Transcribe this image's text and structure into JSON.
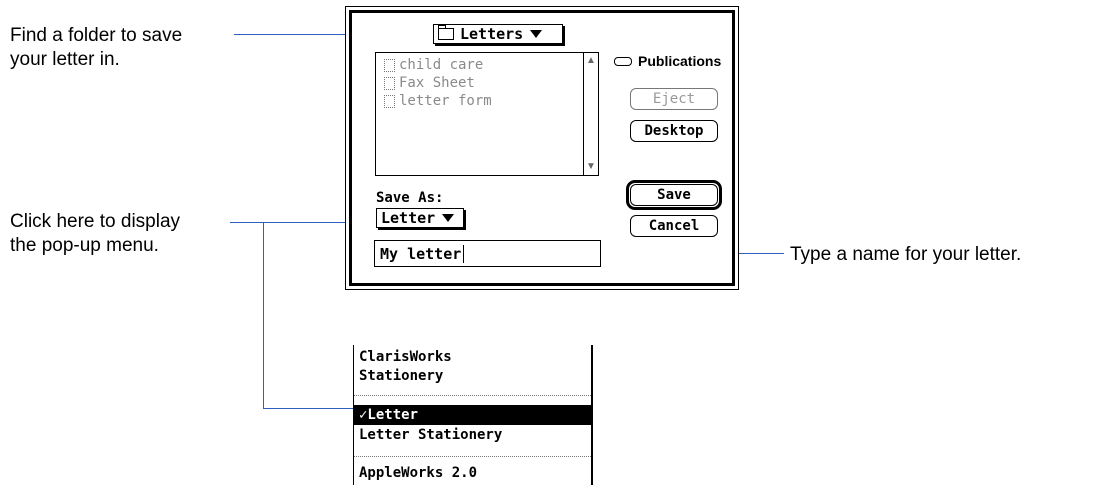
{
  "annotations": {
    "folder_line1": "Find a folder to save",
    "folder_line2": "your letter in.",
    "popup_line1": "Click here to display",
    "popup_line2": "the pop-up menu.",
    "name_hint": "Type a name for your letter."
  },
  "dialog": {
    "folder_popup": "Letters",
    "files": [
      "child care",
      "Fax Sheet",
      "letter form"
    ],
    "disk_name": "Publications",
    "buttons": {
      "eject": "Eject",
      "desktop": "Desktop",
      "save": "Save",
      "cancel": "Cancel"
    },
    "save_as_label": "Save As:",
    "format_popup": "Letter",
    "file_name": "My letter"
  },
  "menu": {
    "items": [
      {
        "label": "ClarisWorks",
        "checked": false
      },
      {
        "label": "Stationery",
        "checked": false
      },
      {
        "label": "✓Letter",
        "checked": true
      },
      {
        "label": "Letter Stationery",
        "checked": false
      },
      {
        "label": "AppleWorks 2.0",
        "checked": false
      }
    ]
  },
  "colors": {
    "callout_line": "#2f5fbf"
  }
}
